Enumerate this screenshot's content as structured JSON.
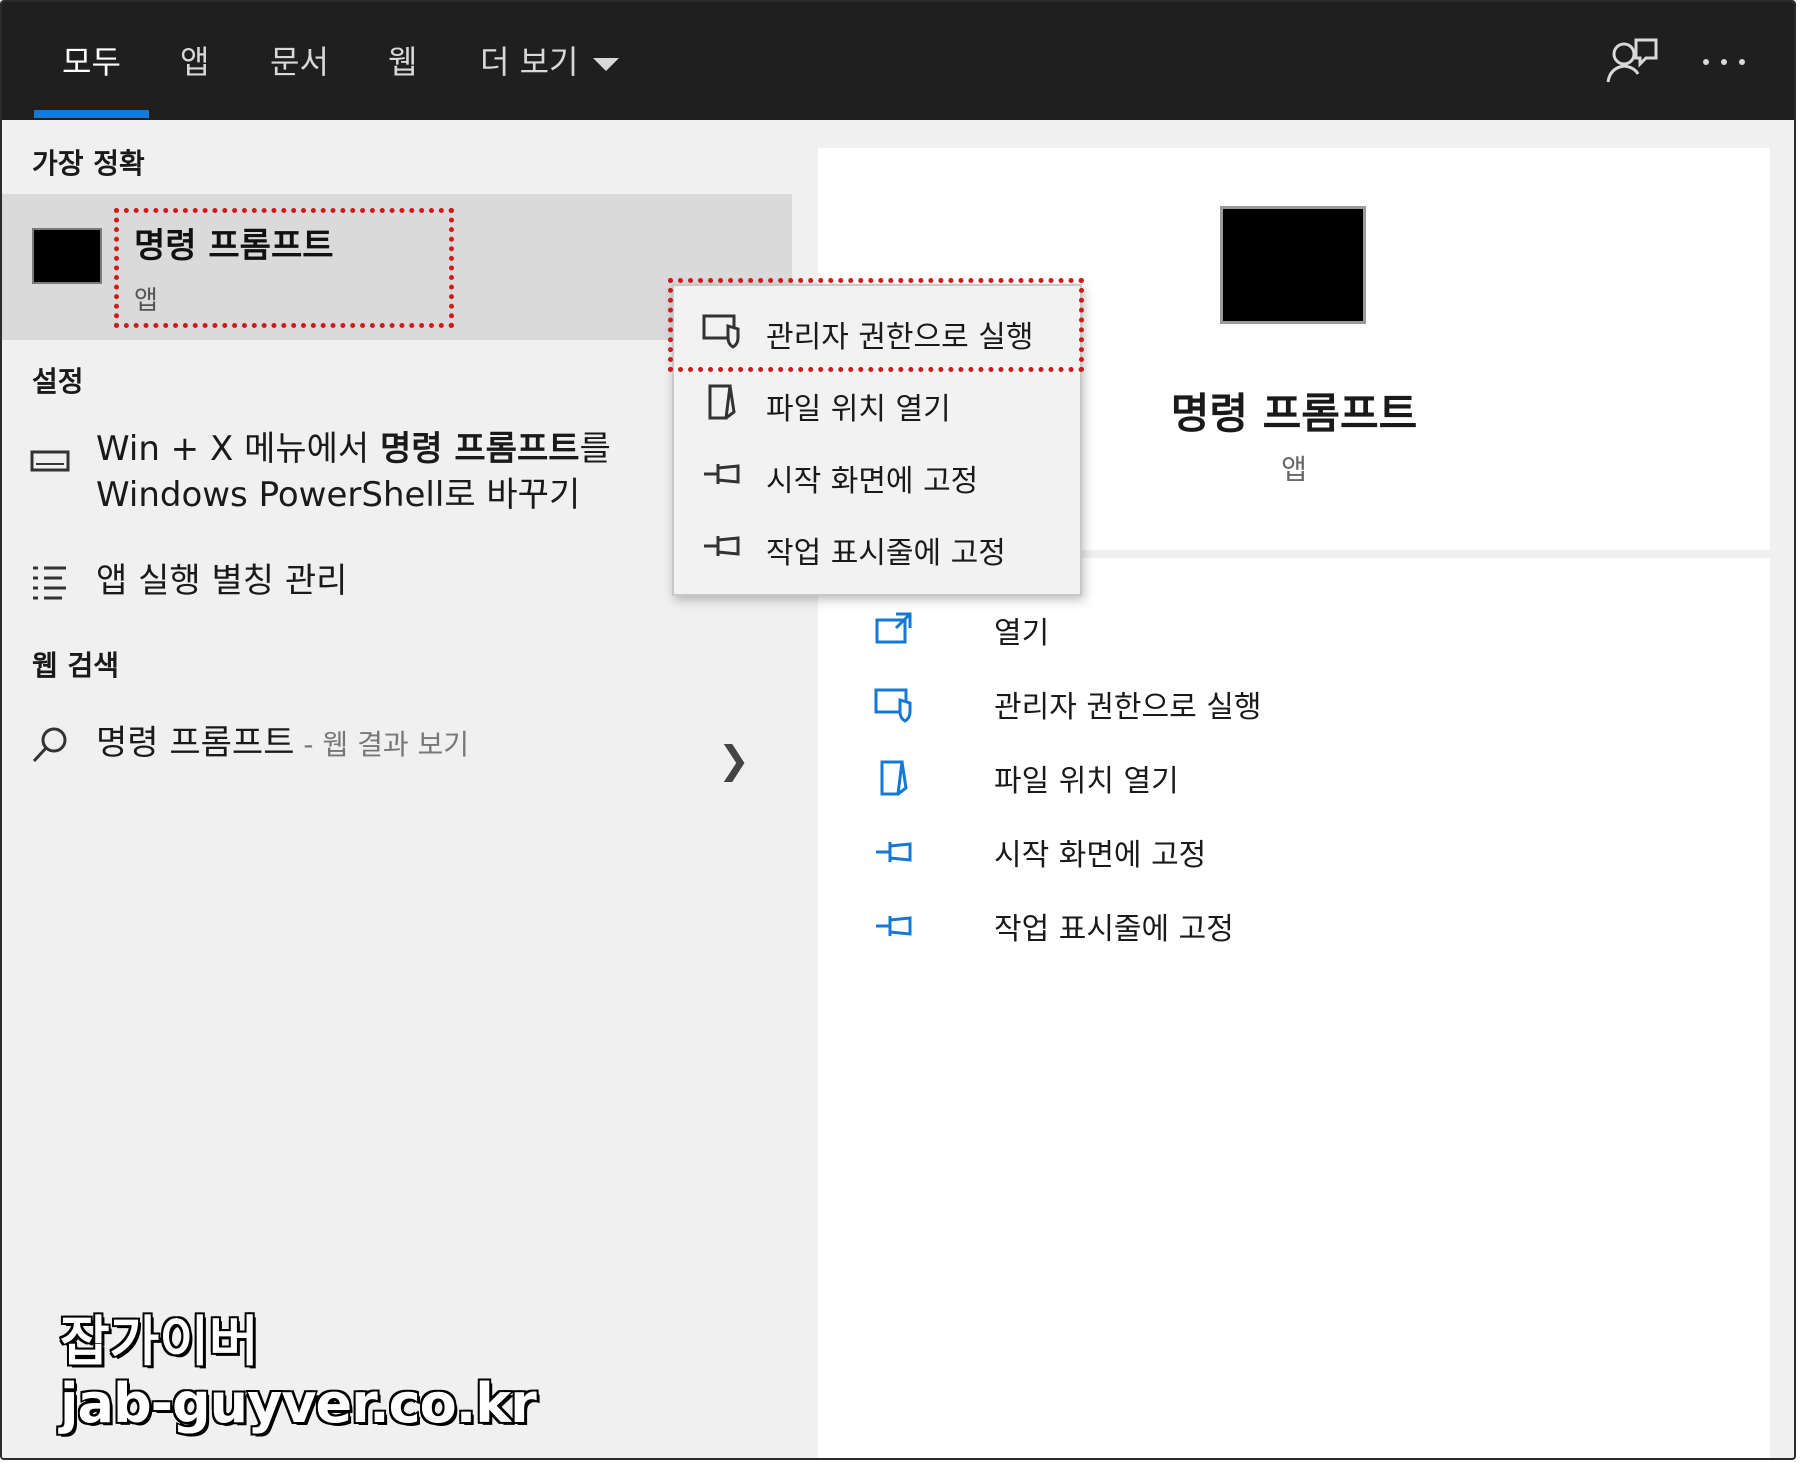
{
  "tabs": [
    {
      "label": "모두",
      "active": true
    },
    {
      "label": "앱",
      "active": false
    },
    {
      "label": "문서",
      "active": false
    },
    {
      "label": "웹",
      "active": false
    },
    {
      "label": "더 보기",
      "active": false
    }
  ],
  "topbar_icons": {
    "feedback": "feedback-icon",
    "more": "more-options-icon"
  },
  "best_match": {
    "section_label": "가장 정확",
    "title": "명령 프롬프트",
    "type": "앱",
    "icon": "command-prompt-icon"
  },
  "settings": {
    "section_label": "설정",
    "items": [
      {
        "icon": "keyboard-icon",
        "text_before": "Win + X 메뉴에서 ",
        "text_bold": "명령 프롬프트",
        "text_after": "를",
        "text_line2": "Windows PowerShell로 바꾸기"
      },
      {
        "icon": "list-icon",
        "text": "앱 실행 별칭 관리"
      }
    ]
  },
  "web_search": {
    "section_label": "웹 검색",
    "query": "명령 프롬프트",
    "hint": " - 웹 결과 보기",
    "icon": "search-icon"
  },
  "detail": {
    "title": "명령 프롬프트",
    "type": "앱",
    "actions": [
      {
        "label": "열기",
        "icon": "open-icon"
      },
      {
        "label": "관리자 권한으로 실행",
        "icon": "shield-window-icon"
      },
      {
        "label": "파일 위치 열기",
        "icon": "folder-icon"
      },
      {
        "label": "시작 화면에 고정",
        "icon": "pin-icon"
      },
      {
        "label": "작업 표시줄에 고정",
        "icon": "pin-icon"
      }
    ]
  },
  "context_menu": {
    "items": [
      {
        "label": "관리자 권한으로 실행",
        "icon": "shield-window-icon",
        "highlighted": true
      },
      {
        "label": "파일 위치 열기",
        "icon": "folder-icon"
      },
      {
        "label": "시작 화면에 고정",
        "icon": "pin-icon"
      },
      {
        "label": "작업 표시줄에 고정",
        "icon": "pin-icon"
      }
    ]
  },
  "watermark": {
    "line1": "잡가이버",
    "line2": "jab-guyver.co.kr"
  },
  "colors": {
    "accent": "#1479d4",
    "highlight_box": "#d11a1a",
    "topbar": "#1f1f1f"
  }
}
